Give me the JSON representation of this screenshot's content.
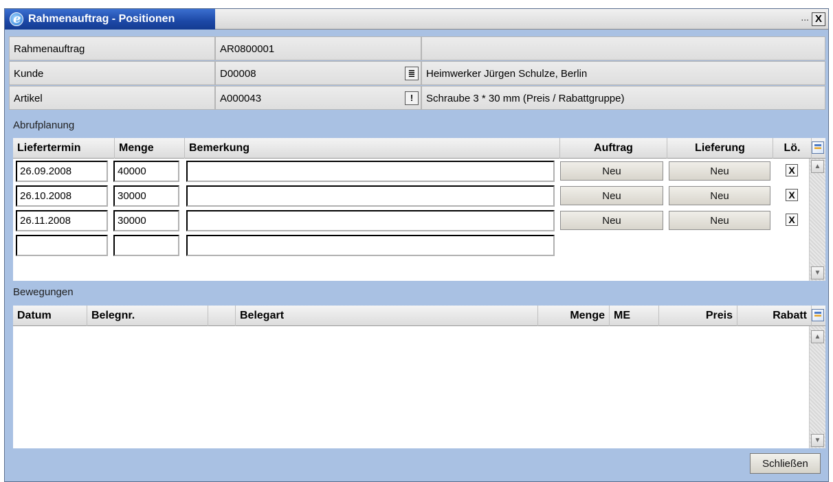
{
  "window": {
    "title": "Rahmenauftrag - Positionen",
    "dots": "...",
    "close": "X"
  },
  "header": {
    "rahmenauftrag": {
      "label": "Rahmenauftrag",
      "value": "AR0800001",
      "desc": ""
    },
    "kunde": {
      "label": "Kunde",
      "value": "D00008",
      "desc": "Heimwerker Jürgen Schulze, Berlin"
    },
    "artikel": {
      "label": "Artikel",
      "value": "A000043",
      "desc": "Schraube 3 * 30 mm (Preis / Rabattgruppe)"
    }
  },
  "abrufplanung": {
    "section_title": "Abrufplanung",
    "columns": {
      "liefertermin": "Liefertermin",
      "menge": "Menge",
      "bemerkung": "Bemerkung",
      "auftrag": "Auftrag",
      "lieferung": "Lieferung",
      "loeschen": "Lö."
    },
    "rows": [
      {
        "liefertermin": "26.09.2008",
        "menge": "40000",
        "bemerkung": "",
        "auftrag": "Neu",
        "lieferung": "Neu",
        "delete": "X"
      },
      {
        "liefertermin": "26.10.2008",
        "menge": "30000",
        "bemerkung": "",
        "auftrag": "Neu",
        "lieferung": "Neu",
        "delete": "X"
      },
      {
        "liefertermin": "26.11.2008",
        "menge": "30000",
        "bemerkung": "",
        "auftrag": "Neu",
        "lieferung": "Neu",
        "delete": "X"
      },
      {
        "liefertermin": "",
        "menge": "",
        "bemerkung": ""
      }
    ]
  },
  "bewegungen": {
    "section_title": "Bewegungen",
    "columns": {
      "datum": "Datum",
      "belegnr": "Belegnr.",
      "belegart": "Belegart",
      "menge": "Menge",
      "me": "ME",
      "preis": "Preis",
      "rabatt": "Rabatt"
    }
  },
  "footer": {
    "close_label": "Schließen"
  },
  "icons": {
    "window_icon": "internet-explorer-icon",
    "lookup_customer": "address-card-icon",
    "lookup_article": "exclamation-icon",
    "column_settings": "column-chooser-icon",
    "scroll_up": "arrow-up-icon",
    "scroll_down": "arrow-down-icon"
  }
}
